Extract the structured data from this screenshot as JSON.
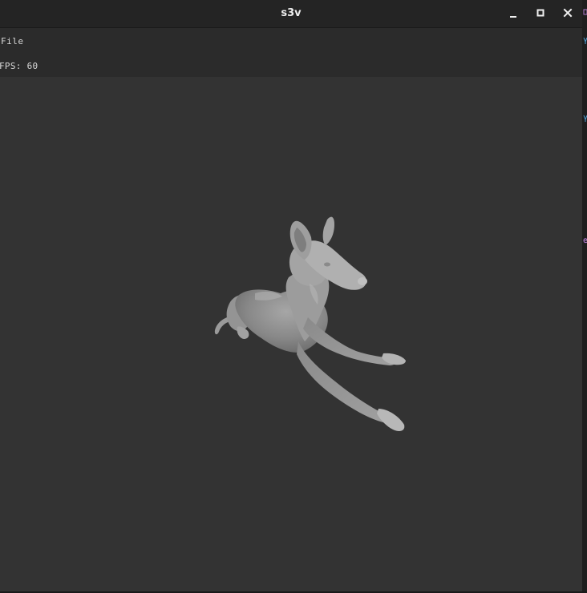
{
  "window": {
    "title": "s3v",
    "controls": {
      "minimize_icon": "minimize-icon",
      "maximize_icon": "maximize-icon",
      "close_icon": "close-icon"
    }
  },
  "menubar": {
    "file_label": "File"
  },
  "status": {
    "fps_text": "FPS: 60"
  },
  "viewport": {
    "background_color": "#333333",
    "model_color": "#8e8e8e"
  },
  "colors": {
    "titlebar": "#242424",
    "menubar": "#2b2b2b",
    "text": "#d8d8d8"
  }
}
